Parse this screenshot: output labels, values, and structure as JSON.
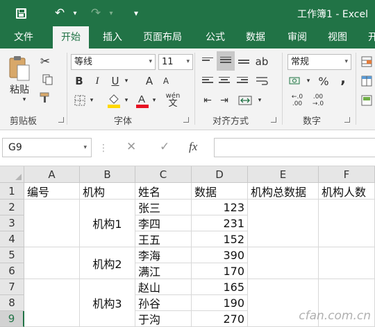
{
  "titlebar": {
    "title": "工作簿1 - Excel",
    "more": "▾"
  },
  "tabs": [
    "文件",
    "开始",
    "插入",
    "页面布局",
    "公式",
    "数据",
    "审阅",
    "视图",
    "开"
  ],
  "ribbon": {
    "clipboard": {
      "paste_label": "粘贴",
      "group_label": "剪贴板"
    },
    "font": {
      "name": "等线",
      "size": "11",
      "bold": "B",
      "italic": "I",
      "underline": "U",
      "grow": "A",
      "shrink": "A",
      "group_label": "字体",
      "phonetic": "wén"
    },
    "alignment": {
      "group_label": "对齐方式"
    },
    "number": {
      "format": "常规",
      "percent": "%",
      "comma": ",",
      "group_label": "数字"
    }
  },
  "formula_bar": {
    "name_box": "G9",
    "fx": "fx",
    "cancel": "✕",
    "enter": "✓",
    "formula": ""
  },
  "grid": {
    "columns": [
      "A",
      "B",
      "C",
      "D",
      "E",
      "F"
    ],
    "rows": [
      "1",
      "2",
      "3",
      "4",
      "5",
      "6",
      "7",
      "8",
      "9"
    ],
    "headers": [
      "编号",
      "机构",
      "姓名",
      "数据",
      "机构总数据",
      "机构人数"
    ],
    "merged": [
      {
        "label": "机构1"
      },
      {
        "label": "机构2"
      },
      {
        "label": "机构3"
      }
    ],
    "records": [
      {
        "name": "张三",
        "value": "123"
      },
      {
        "name": "李四",
        "value": "231"
      },
      {
        "name": "王五",
        "value": "152"
      },
      {
        "name": "李海",
        "value": "390"
      },
      {
        "name": "满江",
        "value": "170"
      },
      {
        "name": "赵山",
        "value": "165"
      },
      {
        "name": "孙谷",
        "value": "190"
      },
      {
        "name": "于沟",
        "value": "270"
      }
    ],
    "selected_cell": "G9"
  },
  "watermark": "cfan.com.cn",
  "colors": {
    "brand": "#217346",
    "ribbon": "#f3f3f3",
    "header": "#e6e6e6"
  }
}
